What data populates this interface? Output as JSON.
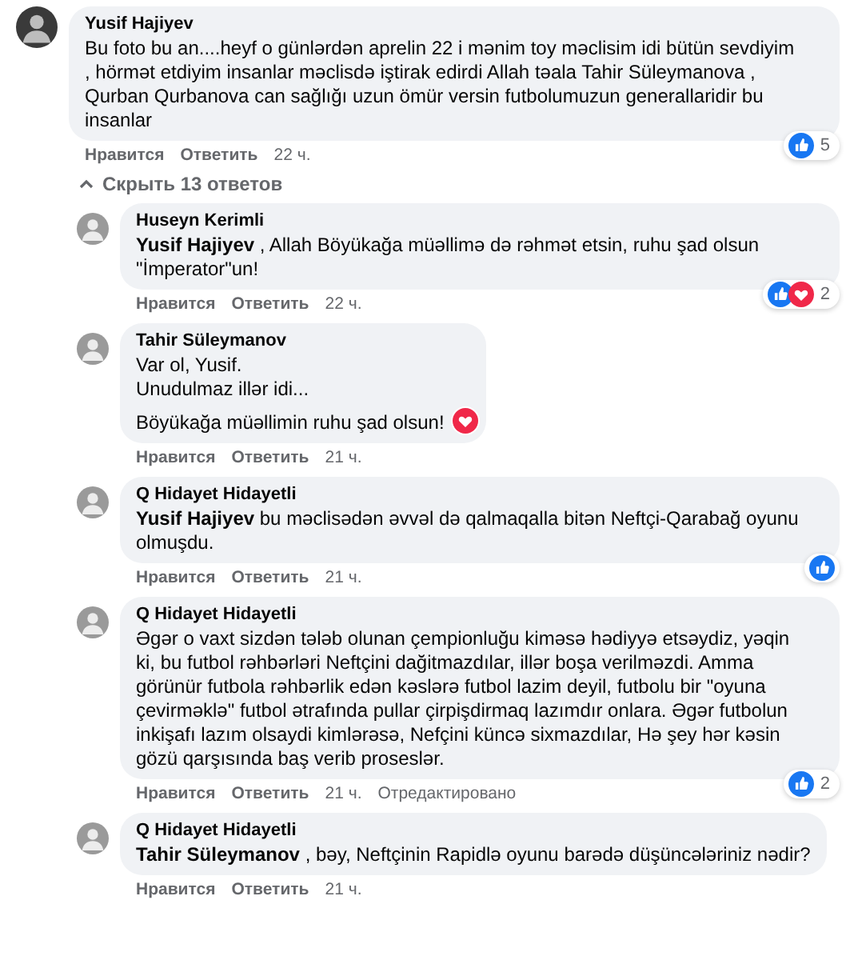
{
  "comments": [
    {
      "author": "Yusif Hajiyev",
      "paragraphs": [
        "Bu foto bu an....heyf o günlərdən aprelin 22 i mənim toy məclisim idi bütün sevdiyim , hörmət etdiyim insanlar məclisdə iştirak edirdi Allah təala Tahir Süleymanova , Qurban Qurbanova can sağlığı uzun ömür versin futbolumuzun generallaridir bu insanlar"
      ],
      "reactions": {
        "icons": [
          {
            "kind": "like"
          }
        ],
        "count": "5"
      },
      "like": "Нравится",
      "reply": "Ответить",
      "time": "22 ч.",
      "toggle": "Скрыть 13 ответов",
      "children": [
        {
          "author": "Huseyn Kerimli",
          "paragraphs": [
            "**Yusif Hajiyev** , Allah Böyükağa müəllimə də rəhmət etsin, ruhu şad olsun \"İmperator\"un!"
          ],
          "reactions": {
            "icons": [
              {
                "kind": "like"
              },
              {
                "kind": "love"
              }
            ],
            "count": "2"
          },
          "like": "Нравится",
          "reply": "Ответить",
          "time": "22 ч."
        },
        {
          "author": "Tahir Süleymanov",
          "paragraphs": [
            "Var ol, Yusif.\nUnudulmaz illər idi...",
            "Böyükağa müəllimin ruhu şad olsun!"
          ],
          "inline_reactions": [
            {
              "kind": "love"
            }
          ],
          "like": "Нравится",
          "reply": "Ответить",
          "time": "21 ч."
        },
        {
          "author": "Q Hidayet Hidayetli",
          "paragraphs": [
            "**Yusif Hajiyev** bu məclisədən əvvəl də qalmaqalla bitən Neftçi-Qarabağ oyunu olmuşdu."
          ],
          "reactions": {
            "icons": [
              {
                "kind": "like"
              }
            ]
          },
          "like": "Нравится",
          "reply": "Ответить",
          "time": "21 ч."
        },
        {
          "author": "Q Hidayet Hidayetli",
          "paragraphs": [
            "Əgər o vaxt sizdən tələb olunan çempionluğu kiməsə hədiyyə etsəydiz, yəqin ki, bu futbol rəhbərləri Neftçini dağitmazdılar, illər boşa verilməzdi. Amma görünür futbola rəhbərlik edən kəslərə futbol lazim deyil, futbolu bir \"oyuna çevirməklə\" futbol ətrafında pullar çirpişdirmaq lazımdır onlara. Əgər futbolun inkişafı lazım olsaydi kimlərəsə, Nefçini küncə sixmazdılar, Hə şey hər kəsin gözü qarşısında baş verib proseslər."
          ],
          "reactions": {
            "icons": [
              {
                "kind": "like"
              }
            ],
            "count": "2"
          },
          "like": "Нравится",
          "reply": "Ответить",
          "time": "21 ч.",
          "edited": "Отредактировано"
        },
        {
          "author": "Q Hidayet Hidayetli",
          "paragraphs": [
            "**Tahir Süleymanov** , bəy, Neftçinin Rapidlə oyunu barədə düşüncələriniz nədir?"
          ],
          "like": "Нравится",
          "reply": "Ответить",
          "time": "21 ч."
        }
      ]
    }
  ]
}
